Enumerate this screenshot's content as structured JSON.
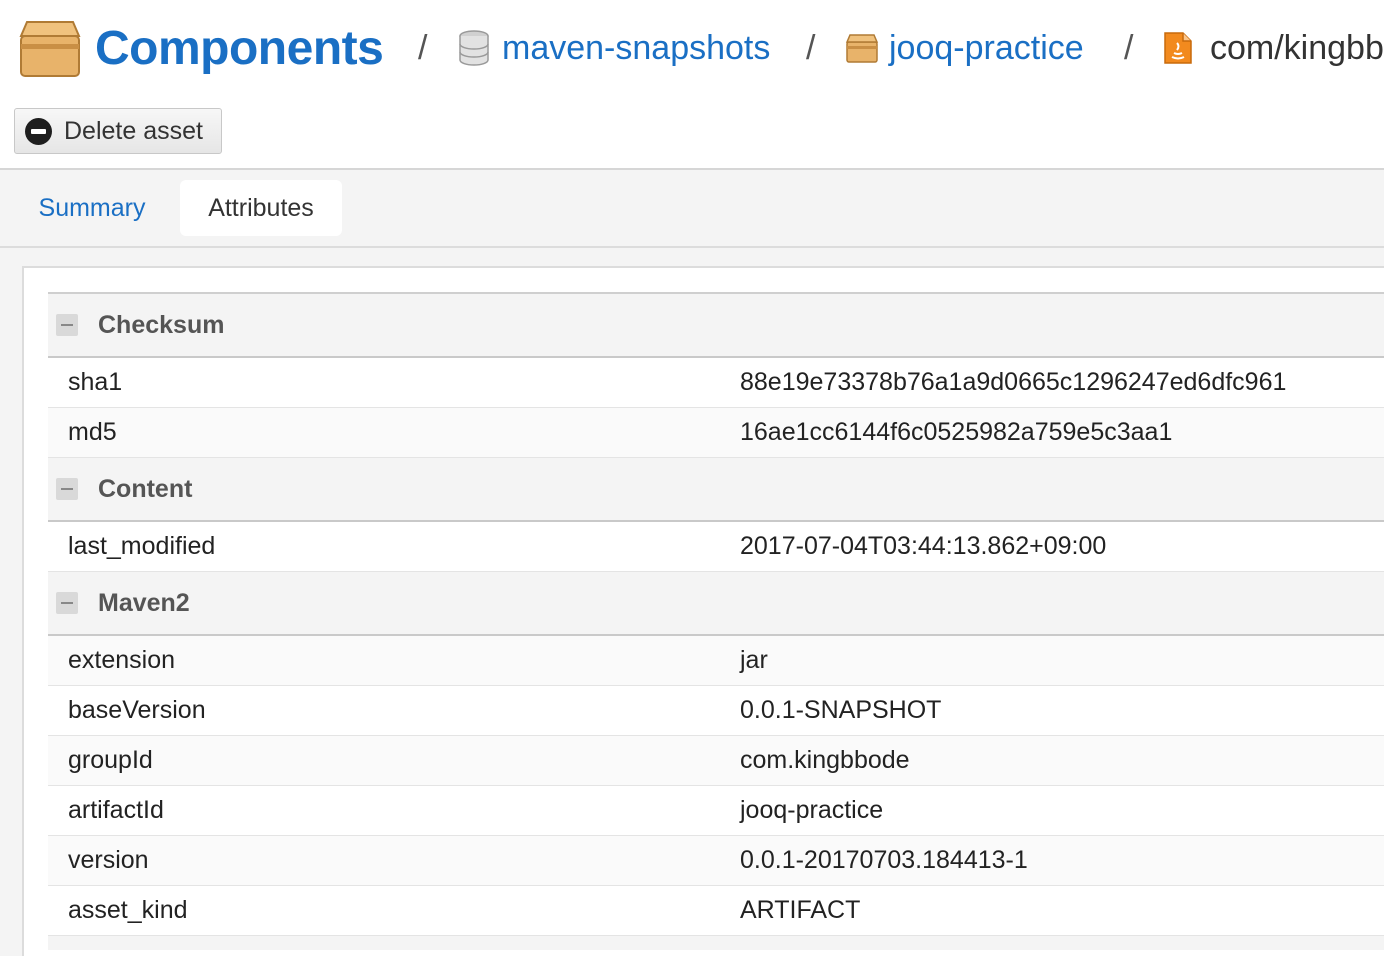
{
  "breadcrumb": {
    "title": "Components",
    "items": [
      {
        "label": "maven-snapshots",
        "icon": "database-icon"
      },
      {
        "label": "jooq-practice",
        "icon": "box-icon"
      },
      {
        "label": "com/kingbb",
        "icon": "java-file-icon"
      }
    ],
    "separator": "/"
  },
  "toolbar": {
    "delete_label": "Delete asset"
  },
  "tabs": [
    {
      "label": "Summary",
      "active": false
    },
    {
      "label": "Attributes",
      "active": true
    }
  ],
  "attributes": {
    "groups": [
      {
        "title": "Checksum",
        "rows": [
          {
            "key": "sha1",
            "value": "88e19e73378b76a1a9d0665c1296247ed6dfc961"
          },
          {
            "key": "md5",
            "value": "16ae1cc6144f6c0525982a759e5c3aa1"
          }
        ]
      },
      {
        "title": "Content",
        "rows": [
          {
            "key": "last_modified",
            "value": "2017-07-04T03:44:13.862+09:00"
          }
        ]
      },
      {
        "title": "Maven2",
        "rows": [
          {
            "key": "extension",
            "value": "jar"
          },
          {
            "key": "baseVersion",
            "value": "0.0.1-SNAPSHOT"
          },
          {
            "key": "groupId",
            "value": "com.kingbbode"
          },
          {
            "key": "artifactId",
            "value": "jooq-practice"
          },
          {
            "key": "version",
            "value": "0.0.1-20170703.184413-1"
          },
          {
            "key": "asset_kind",
            "value": "ARTIFACT"
          }
        ]
      }
    ]
  },
  "colors": {
    "link": "#1a6fc4",
    "box_icon": "#e8b36a",
    "java_icon": "#f28a1e"
  }
}
